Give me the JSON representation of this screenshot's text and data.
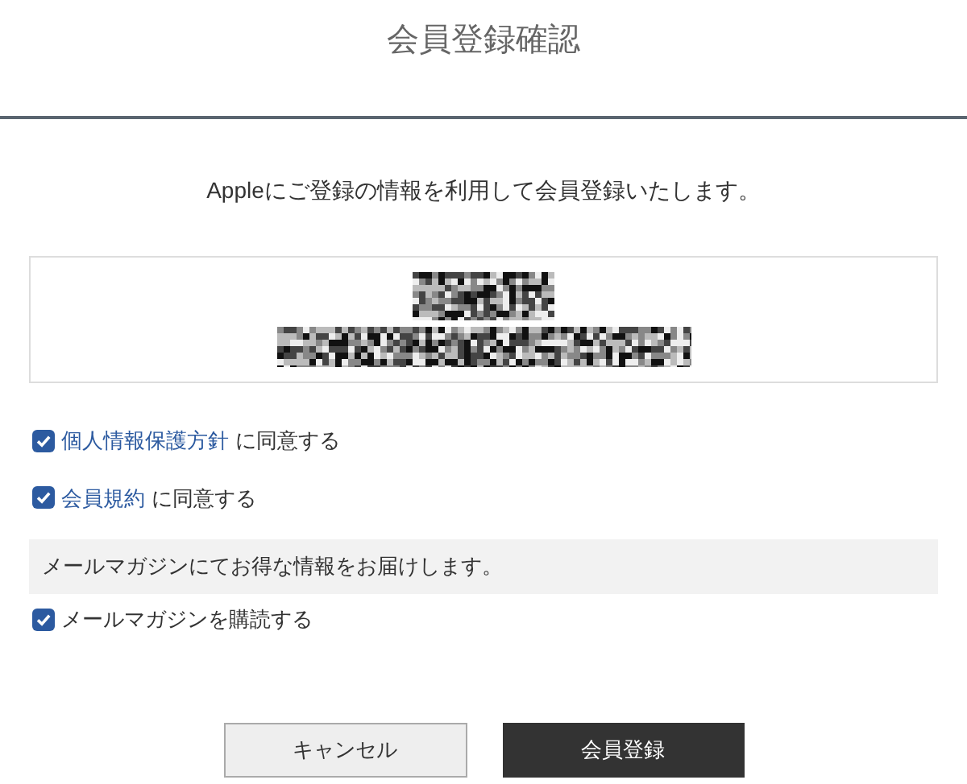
{
  "title": "会員登録確認",
  "intro": "Appleにご登録の情報を利用して会員登録いたします。",
  "agreements": [
    {
      "link": "個人情報保護方針",
      "text": "に同意する",
      "checked": true
    },
    {
      "link": "会員規約",
      "text": "に同意する",
      "checked": true
    }
  ],
  "newsletter": {
    "note": "メールマガジンにてお得な情報をお届けします。",
    "label": "メールマガジンを購読する",
    "checked": true
  },
  "buttons": [
    {
      "label": "キャンセル",
      "kind": "secondary"
    },
    {
      "label": "会員登録",
      "kind": "primary"
    }
  ]
}
